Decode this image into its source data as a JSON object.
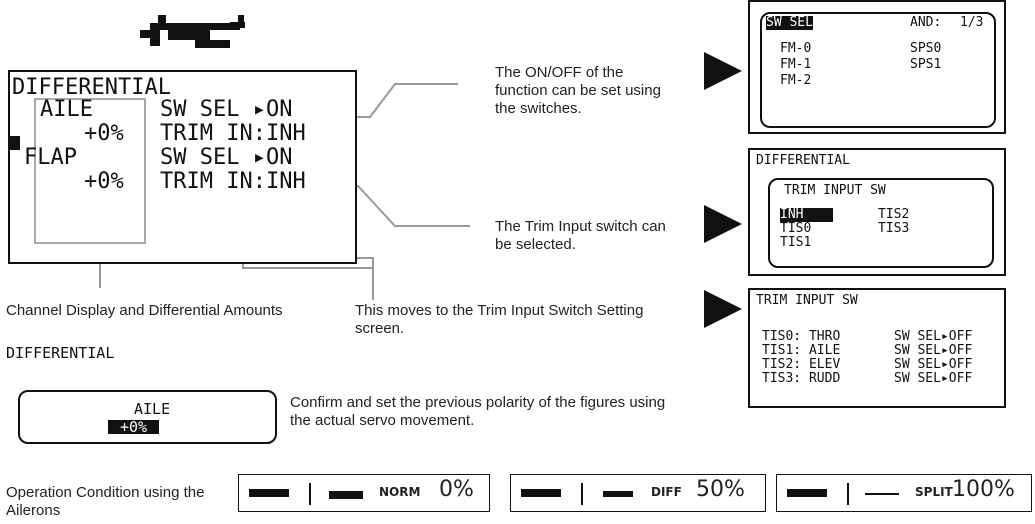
{
  "main_screen": {
    "title": "DIFFERENTIAL",
    "aile_label": "AILE",
    "aile_value": "+0%",
    "flap_label": "FLAP",
    "flap_value": "+0%",
    "sw_sel_1": "SW SEL ▸ON",
    "trim_in_1": "TRIM IN:INH",
    "sw_sel_2": "SW SEL ▸ON",
    "trim_in_2": "TRIM IN:INH"
  },
  "callouts": {
    "onoff": "The ON/OFF of the function can be set using the switches.",
    "trim_input": "The Trim Input switch can be selected.",
    "channel": "Channel Display and Differential Amounts",
    "moves": "This moves to the Trim Input Switch Setting screen."
  },
  "sw_sel_screen": {
    "title": "SW SEL",
    "and": "AND:",
    "page": "1/3",
    "fm0": "FM-0",
    "fm1": "FM-1",
    "fm2": "FM-2",
    "sps0": "SPS0",
    "sps1": "SPS1"
  },
  "trim_popup": {
    "header": "DIFFERENTIAL",
    "title": "TRIM INPUT SW",
    "inh": "INH",
    "tis0": "TIS0",
    "tis1": "TIS1",
    "tis2": "TIS2",
    "tis3": "TIS3"
  },
  "trim_input_screen": {
    "title": "TRIM INPUT SW",
    "rows": [
      {
        "label": "TIS0: THRO",
        "sw": "SW SEL▸OFF"
      },
      {
        "label": "TIS1: AILE",
        "sw": "SW SEL▸OFF"
      },
      {
        "label": "TIS2: ELEV",
        "sw": "SW SEL▸OFF"
      },
      {
        "label": "TIS3: RUDD",
        "sw": "SW SEL▸OFF"
      }
    ]
  },
  "bottom": {
    "title": "DIFFERENTIAL",
    "channel": "AILE",
    "value": "+0%",
    "note": "Confirm and set the previous polarity of the figures using the actual servo movement.",
    "operation": "Operation Condition using the Ailerons"
  },
  "conditions": [
    {
      "name": "NORM",
      "pct": "0%"
    },
    {
      "name": "DIFF",
      "pct": "50%"
    },
    {
      "name": "SPLIT",
      "pct": "100%"
    }
  ],
  "icons": {
    "plane": "airplane-icon",
    "arrow": "right-arrow-icon",
    "cursor": "cursor-left-icon"
  }
}
